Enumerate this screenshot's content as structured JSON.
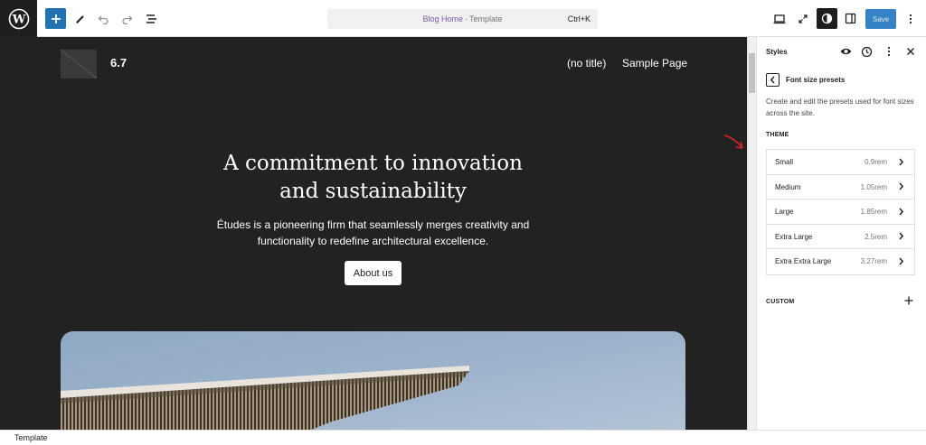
{
  "topbar": {
    "document_title": "Blog Home",
    "document_separator": "·",
    "document_type": "Template",
    "shortcut": "Ctrl+K",
    "save_label": "Save"
  },
  "canvas": {
    "site_title": "6.7",
    "nav": [
      "(no title)",
      "Sample Page"
    ],
    "hero_title_line1": "A commitment to innovation",
    "hero_title_line2": "and sustainability",
    "hero_text": "Études is a pioneering firm that seamlessly merges creativity and functionality to redefine architectural excellence.",
    "cta_label": "About us"
  },
  "sidebar": {
    "title": "Styles",
    "panel_title": "Font size presets",
    "panel_description": "Create and edit the presets used for font sizes across the site.",
    "theme_label": "THEME",
    "presets": [
      {
        "name": "Small",
        "size": "0.9rem"
      },
      {
        "name": "Medium",
        "size": "1.05rem"
      },
      {
        "name": "Large",
        "size": "1.85rem"
      },
      {
        "name": "Extra Large",
        "size": "2.5rem"
      },
      {
        "name": "Extra Extra Large",
        "size": "3.27rem"
      }
    ],
    "custom_label": "CUSTOM"
  },
  "footer": {
    "breadcrumb": "Template"
  },
  "colors": {
    "accent": "#2271b1",
    "canvas_bg": "#222222",
    "annotation_arrow": "#e02424"
  }
}
